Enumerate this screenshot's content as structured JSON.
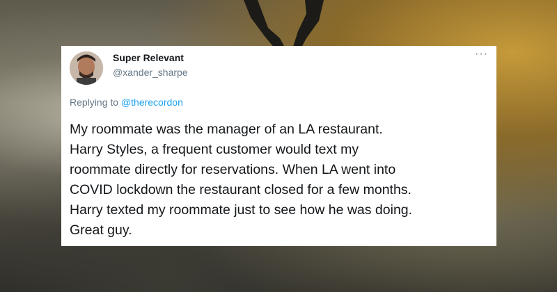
{
  "tweet": {
    "display_name": "Super Relevant",
    "handle": "@xander_sharpe",
    "more_label": "···",
    "replying_prefix": "Replying to ",
    "replying_to": "@therecordon",
    "text": "My roommate was the manager of an LA restaurant.\nHarry Styles, a frequent customer would text my\nroommate directly for reservations. When LA went into\nCOVID lockdown the restaurant closed for a few months.\nHarry texted my roommate just to see how he was doing.\nGreat guy."
  },
  "colors": {
    "link": "#1da1f2",
    "secondary_text": "#657786",
    "primary_text": "#14171a",
    "card_bg": "#ffffff"
  },
  "icons": {
    "more": "more-horizontal-icon"
  }
}
